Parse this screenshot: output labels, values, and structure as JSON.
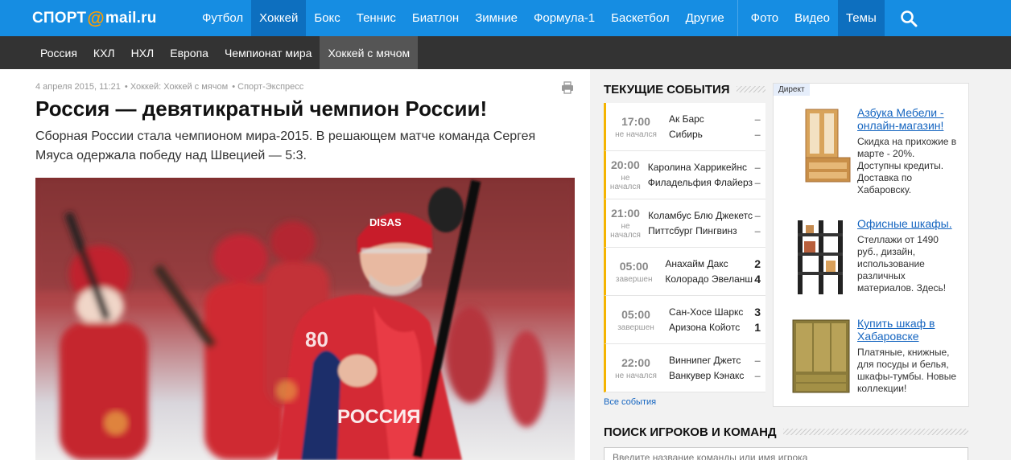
{
  "logo": {
    "part1": "СПОРТ",
    "at": "@",
    "part2": "mail.ru"
  },
  "nav": [
    "Футбол",
    "Хоккей",
    "Бокс",
    "Теннис",
    "Биатлон",
    "Зимние",
    "Формула-1",
    "Баскетбол",
    "Другие"
  ],
  "nav_extra": [
    "Фото",
    "Видео",
    "Темы"
  ],
  "subnav": [
    "Россия",
    "КХЛ",
    "НХЛ",
    "Европа",
    "Чемпионат мира",
    "Хоккей с мячом"
  ],
  "article": {
    "date": "4 апреля 2015, 11:21",
    "category": "Хоккей: Хоккей с мячом",
    "source": "Спорт-Экспресс",
    "title": "Россия — девятикратный чемпион России!",
    "lead": "Сборная России стала чемпионом мира-2015. В решающем матче команда Сергея Мяуса одержала победу над Швецией — 5:3.",
    "photo_text": {
      "sponsor": "DISAS",
      "jersey": "РОССИЯ",
      "number": "80"
    }
  },
  "events": {
    "title": "ТЕКУЩИЕ СОБЫТИЯ",
    "items": [
      {
        "time": "17:00",
        "status": "не начался",
        "home": "Ак Барс",
        "away": "Сибирь",
        "home_score": "–",
        "away_score": "–"
      },
      {
        "time": "20:00",
        "status": "не начался",
        "home": "Каролина Харрикейнс",
        "away": "Филадельфия Флайерз",
        "home_score": "–",
        "away_score": "–"
      },
      {
        "time": "21:00",
        "status": "не начался",
        "home": "Коламбус Блю Джекетс",
        "away": "Питтсбург Пингвинз",
        "home_score": "–",
        "away_score": "–"
      },
      {
        "time": "05:00",
        "status": "завершен",
        "home": "Анахайм Дакс",
        "away": "Колорадо Эвеланш",
        "home_score": "2",
        "away_score": "4"
      },
      {
        "time": "05:00",
        "status": "завершен",
        "home": "Сан-Хосе Шаркс",
        "away": "Аризона Койотс",
        "home_score": "3",
        "away_score": "1"
      },
      {
        "time": "22:00",
        "status": "не начался",
        "home": "Виннипег Джетс",
        "away": "Ванкувер Кэнакс",
        "home_score": "–",
        "away_score": "–"
      }
    ],
    "all_link": "Все события"
  },
  "ads": {
    "tag": "Директ",
    "items": [
      {
        "title": "Азбука Мебели - онлайн-магазин!",
        "desc": "Скидка на прихожие в марте - 20%. Доступны кредиты. Доставка по Хабаровску."
      },
      {
        "title": "Офисные шкафы.",
        "desc": "Стеллажи от 1490 руб., дизайн, использование различных материалов. Здесь!"
      },
      {
        "title": "Купить шкаф в Хабаровске",
        "desc": "Платяные, книжные, для посуды и белья, шкафы-тумбы. Новые коллекции!"
      }
    ]
  },
  "search": {
    "title": "ПОИСК ИГРОКОВ И КОМАНД",
    "placeholder": "Введите название команды или имя игрока"
  }
}
